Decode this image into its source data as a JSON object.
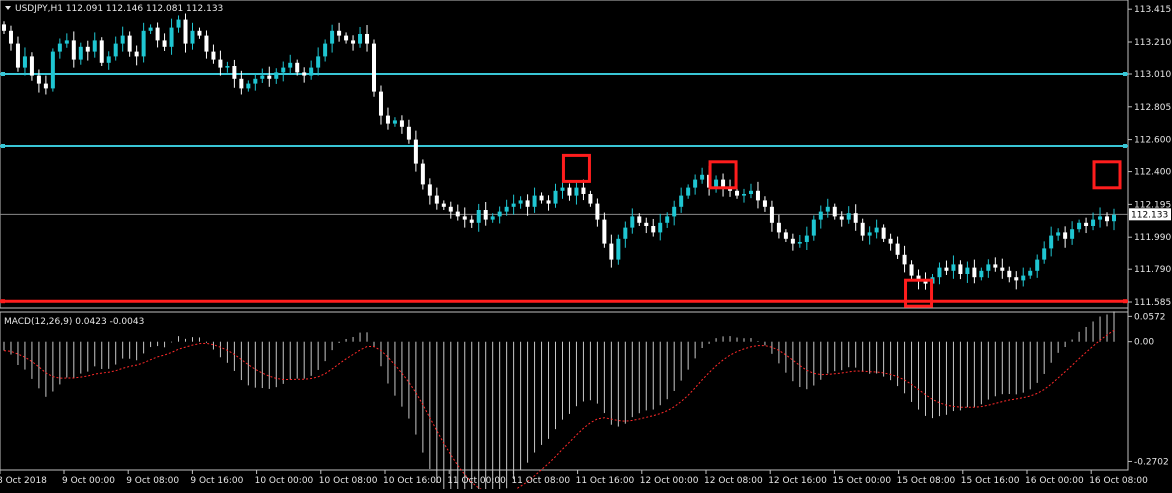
{
  "chart_title": "USDJPY,H1  112.091 112.146 112.081 112.133",
  "macd_label": "MACD(12,26,9) 0.0423 -0.0043",
  "price_tag": "112.133",
  "colors": {
    "background": "#000000",
    "bull_candle": "#1fc6d2",
    "bear_candle": "#ffffff",
    "hline_cyan": "#39c6d6",
    "hline_red": "#ff1d1d",
    "marker_red": "#ff1d1d",
    "macd_hist": "#c8c8c8",
    "macd_signal": "#ff2a2a",
    "axis_text": "#e6e6e6"
  },
  "chart_data": [
    {
      "type": "candlestick",
      "title": "USDJPY,H1",
      "ohlc_last": {
        "open": 112.091,
        "high": 112.146,
        "low": 112.081,
        "close": 112.133
      },
      "ylim": [
        111.56,
        113.46
      ],
      "y_ticks": [
        "113.415",
        "113.210",
        "113.010",
        "112.805",
        "112.600",
        "112.400",
        "112.195",
        "111.990",
        "111.790",
        "111.585"
      ],
      "x_ticks": [
        "8 Oct 2018",
        "9 Oct 00:00",
        "9 Oct 08:00",
        "9 Oct 16:00",
        "10 Oct 00:00",
        "10 Oct 08:00",
        "10 Oct 16:00",
        "11 Oct 00:00",
        "11 Oct 08:00",
        "11 Oct 16:00",
        "12 Oct 00:00",
        "12 Oct 08:00",
        "12 Oct 16:00",
        "15 Oct 00:00",
        "15 Oct 08:00",
        "15 Oct 16:00",
        "16 Oct 00:00",
        "16 Oct 08:00"
      ],
      "horizontal_lines": [
        {
          "price": 113.01,
          "color": "cyan"
        },
        {
          "price": 112.56,
          "color": "cyan"
        },
        {
          "price": 111.59,
          "color": "red"
        }
      ],
      "markers": [
        {
          "index": 82,
          "price": 112.42
        },
        {
          "index": 103,
          "price": 112.38
        },
        {
          "index": 131,
          "price": 111.64
        },
        {
          "index": 158,
          "price": 112.38
        }
      ],
      "closes": [
        113.28,
        113.2,
        113.05,
        113.12,
        113.0,
        112.95,
        112.92,
        113.15,
        113.2,
        113.22,
        113.1,
        113.18,
        113.15,
        113.22,
        113.08,
        113.12,
        113.2,
        113.25,
        113.15,
        113.12,
        113.28,
        113.3,
        113.22,
        113.18,
        113.3,
        113.35,
        113.2,
        113.28,
        113.25,
        113.15,
        113.1,
        113.05,
        113.06,
        112.98,
        112.92,
        112.95,
        112.98,
        113.0,
        112.98,
        113.02,
        113.05,
        113.08,
        113.02,
        113.0,
        113.05,
        113.12,
        113.2,
        113.28,
        113.25,
        113.22,
        113.2,
        113.26,
        113.2,
        112.9,
        112.75,
        112.7,
        112.72,
        112.68,
        112.6,
        112.45,
        112.32,
        112.25,
        112.2,
        112.18,
        112.15,
        112.12,
        112.1,
        112.08,
        112.16,
        112.1,
        112.12,
        112.15,
        112.18,
        112.2,
        112.22,
        112.18,
        112.25,
        112.22,
        112.2,
        112.28,
        112.3,
        112.25,
        112.3,
        112.26,
        112.2,
        112.1,
        111.95,
        111.85,
        111.98,
        112.05,
        112.12,
        112.08,
        112.06,
        112.02,
        112.08,
        112.12,
        112.18,
        112.25,
        112.3,
        112.35,
        112.38,
        112.3,
        112.35,
        112.3,
        112.28,
        112.25,
        112.26,
        112.28,
        112.22,
        112.18,
        112.08,
        112.02,
        111.98,
        111.95,
        111.96,
        112.0,
        112.1,
        112.15,
        112.18,
        112.12,
        112.1,
        112.14,
        112.08,
        112.0,
        112.02,
        112.05,
        111.98,
        111.95,
        111.88,
        111.82,
        111.75,
        111.72,
        111.7,
        111.74,
        111.8,
        111.78,
        111.82,
        111.76,
        111.8,
        111.74,
        111.78,
        111.82,
        111.8,
        111.78,
        111.74,
        111.72,
        111.75,
        111.78,
        111.85,
        111.92,
        112.0,
        112.02,
        111.98,
        112.04,
        112.08,
        112.06,
        112.1,
        112.12,
        112.09,
        112.13
      ]
    },
    {
      "type": "bar",
      "title": "MACD(12,26,9)",
      "values_reported": {
        "macd": 0.0423,
        "signal": -0.0043
      },
      "ylim": [
        -0.285,
        0.0625
      ],
      "y_ticks": [
        "0.0572",
        "0.00",
        "-0.2702"
      ]
    }
  ]
}
